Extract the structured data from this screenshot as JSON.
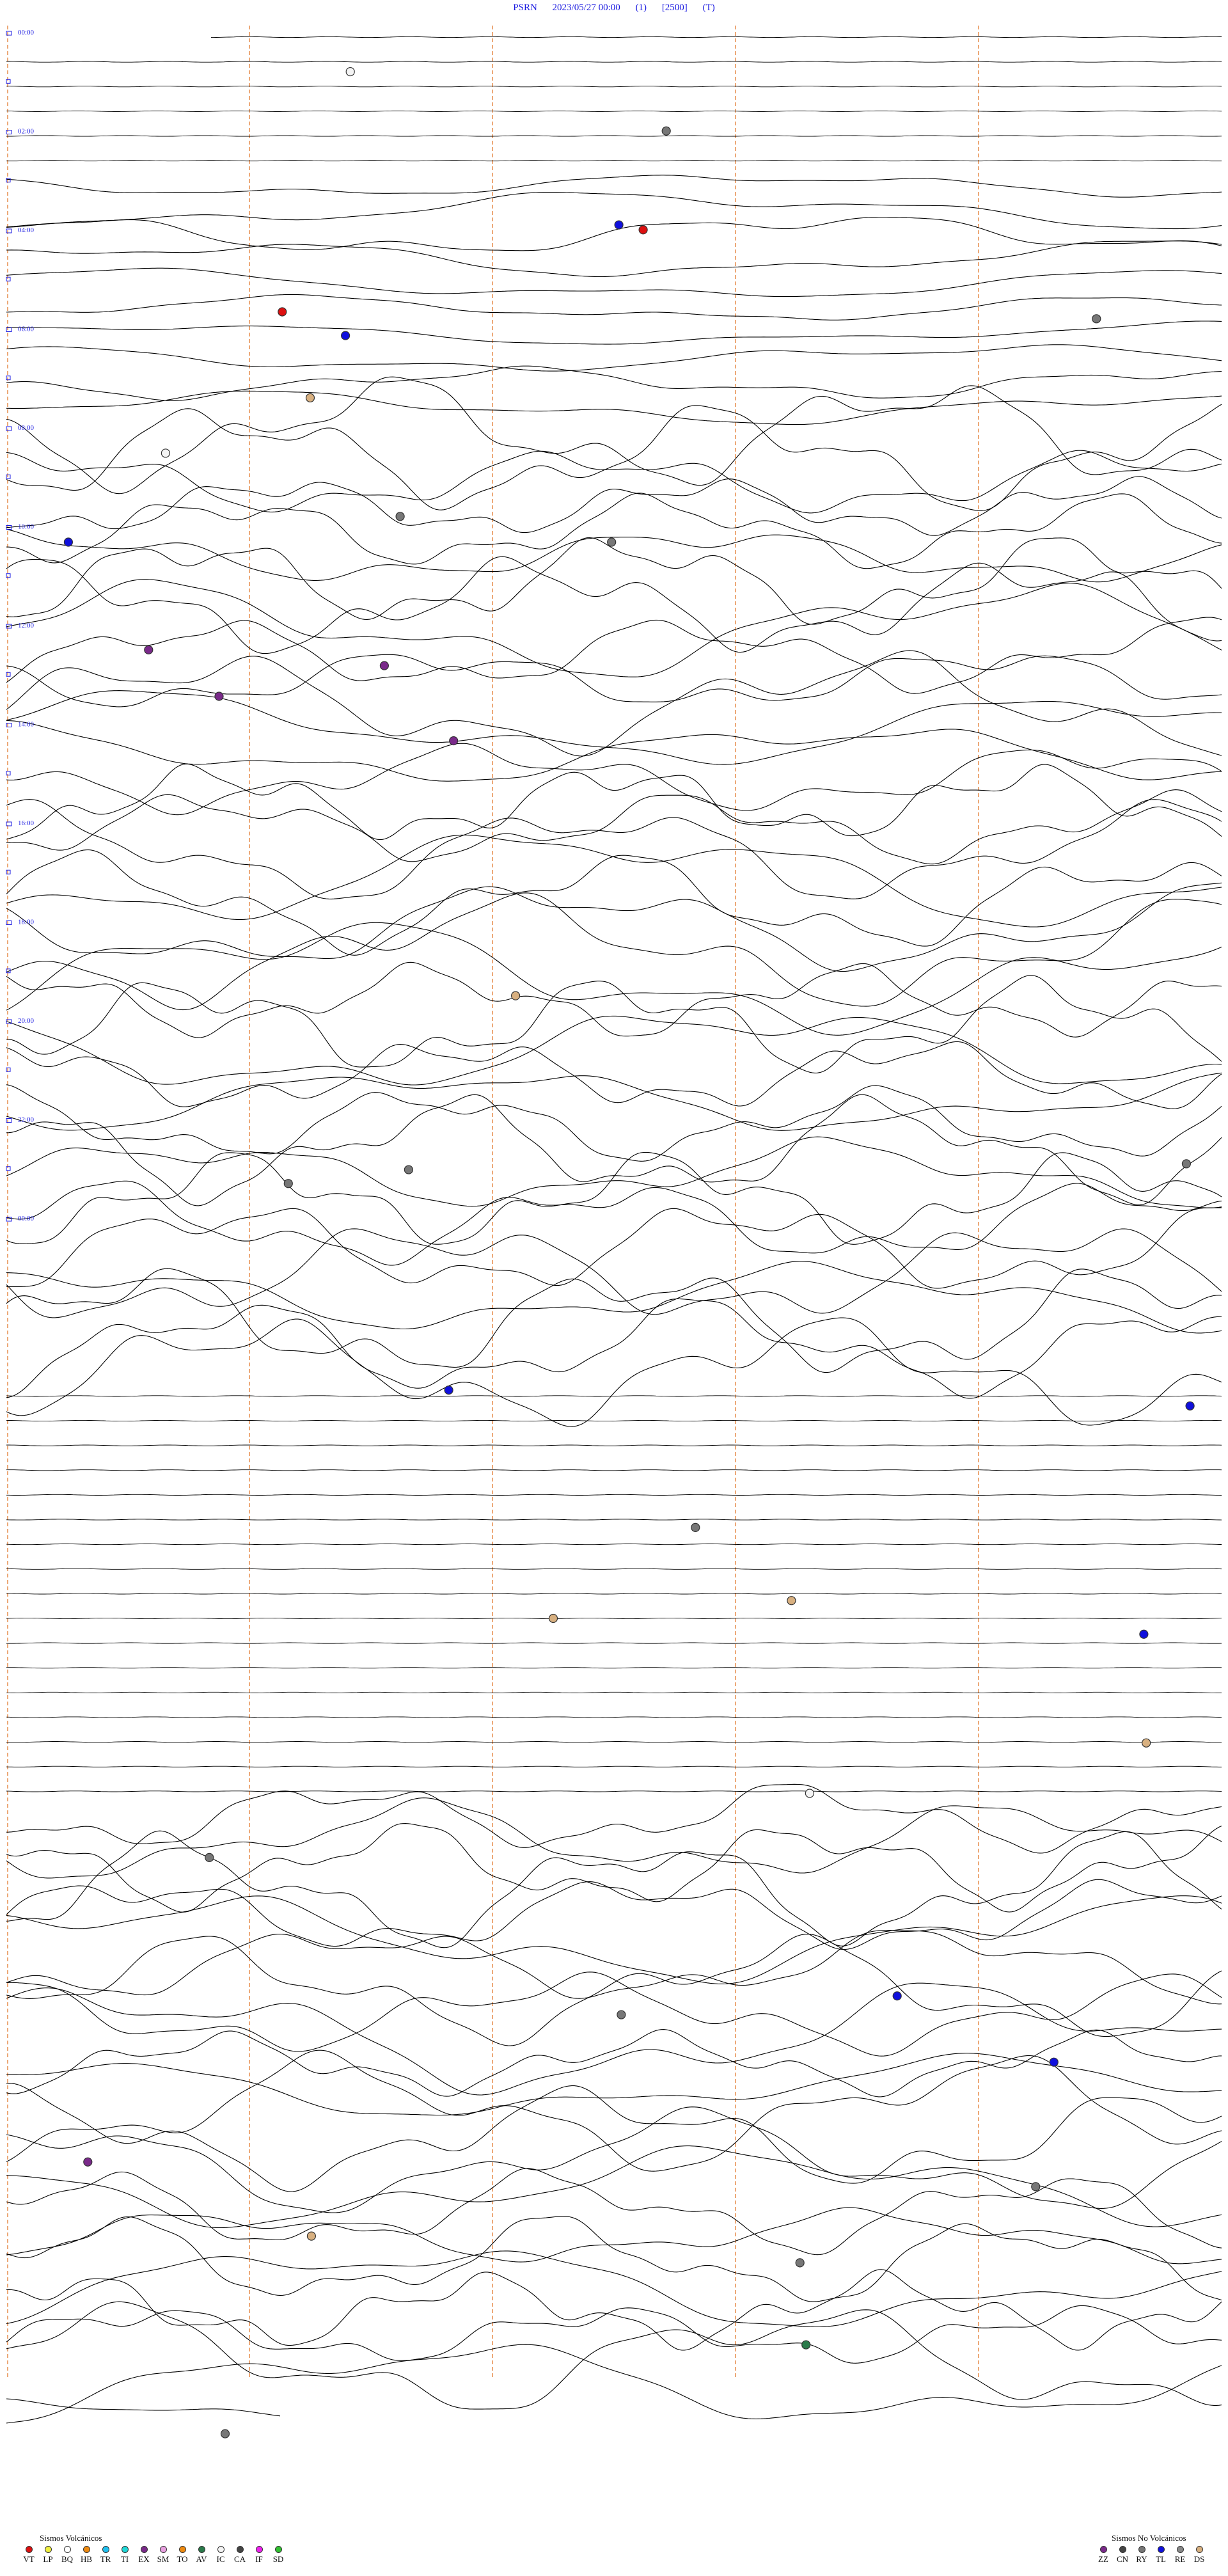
{
  "header": {
    "station": "PSRN",
    "datetime": "2023/05/27 00:00",
    "channel": "(1)",
    "gain": "[2500]",
    "flag": "(T)"
  },
  "chart_data": {
    "type": "helicorder",
    "title": "",
    "hour_labels": [
      "00:00",
      "02:00",
      "04:00",
      "06:00",
      "08:00",
      "10:00",
      "12:00",
      "14:00",
      "16:00",
      "18:00",
      "20:00",
      "22:00",
      "00:00"
    ],
    "rows_per_hour": 4,
    "total_rows": 97,
    "grid_dashed_positions": [
      0,
      0.2,
      0.4,
      0.6,
      0.8
    ],
    "grid_color": "#e07020",
    "trace_color": "#000000",
    "activity_periods": [
      {
        "from_hour": 1.4,
        "to_hour": 3.9,
        "level": "low"
      },
      {
        "from_hour": 4.0,
        "to_hour": 13.6,
        "level": "high"
      },
      {
        "from_hour": 13.7,
        "to_hour": 17.8,
        "level": "quiet"
      },
      {
        "from_hour": 17.9,
        "to_hour": 23.8,
        "level": "high"
      },
      {
        "from_hour": 23.9,
        "to_hour": 24.3,
        "level": "low"
      }
    ],
    "events": [
      {
        "type": "IC",
        "color": "#f4f4f4",
        "x": 0.283,
        "hour": 0.35
      },
      {
        "type": "CA",
        "color": "#777777",
        "x": 0.543,
        "hour": 0.95
      },
      {
        "type": "TL",
        "color": "#1010dd",
        "x": 0.504,
        "hour": 1.9
      },
      {
        "type": "VT",
        "color": "#dd1010",
        "x": 0.524,
        "hour": 1.95
      },
      {
        "type": "VT",
        "color": "#dd1010",
        "x": 0.227,
        "hour": 2.78
      },
      {
        "type": "TL",
        "color": "#1010dd",
        "x": 0.279,
        "hour": 3.02
      },
      {
        "type": "CA",
        "color": "#777777",
        "x": 0.897,
        "hour": 2.85
      },
      {
        "type": "RE",
        "color": "#d8b080",
        "x": 0.25,
        "hour": 3.65
      },
      {
        "type": "IC",
        "color": "#f4f4f4",
        "x": 0.131,
        "hour": 4.21
      },
      {
        "type": "CA",
        "color": "#777777",
        "x": 0.324,
        "hour": 4.85
      },
      {
        "type": "TL",
        "color": "#1010dd",
        "x": 0.051,
        "hour": 5.11
      },
      {
        "type": "CA",
        "color": "#777777",
        "x": 0.498,
        "hour": 5.11
      },
      {
        "type": "ZZ",
        "color": "#7a2a8a",
        "x": 0.117,
        "hour": 6.2
      },
      {
        "type": "ZZ",
        "color": "#7a2a8a",
        "x": 0.311,
        "hour": 6.36
      },
      {
        "type": "ZZ",
        "color": "#7a2a8a",
        "x": 0.175,
        "hour": 6.67
      },
      {
        "type": "ZZ",
        "color": "#7a2a8a",
        "x": 0.368,
        "hour": 7.12
      },
      {
        "type": "RE",
        "color": "#d8b080",
        "x": 0.419,
        "hour": 9.7
      },
      {
        "type": "CA",
        "color": "#777777",
        "x": 0.232,
        "hour": 11.6
      },
      {
        "type": "CA",
        "color": "#777777",
        "x": 0.331,
        "hour": 11.46
      },
      {
        "type": "CA",
        "color": "#777777",
        "x": 0.971,
        "hour": 11.4
      },
      {
        "type": "TL",
        "color": "#1010dd",
        "x": 0.364,
        "hour": 13.69
      },
      {
        "type": "TL",
        "color": "#1010dd",
        "x": 0.974,
        "hour": 13.85
      },
      {
        "type": "CA",
        "color": "#777777",
        "x": 0.567,
        "hour": 15.08
      },
      {
        "type": "RE",
        "color": "#d8b080",
        "x": 0.646,
        "hour": 15.82
      },
      {
        "type": "RE",
        "color": "#d8b080",
        "x": 0.45,
        "hour": 16.0
      },
      {
        "type": "TL",
        "color": "#1010dd",
        "x": 0.936,
        "hour": 16.16
      },
      {
        "type": "RE",
        "color": "#d8b080",
        "x": 0.938,
        "hour": 17.26
      },
      {
        "type": "IC",
        "color": "#f4f4f4",
        "x": 0.661,
        "hour": 17.77
      },
      {
        "type": "CA",
        "color": "#777777",
        "x": 0.167,
        "hour": 18.42
      },
      {
        "type": "TL",
        "color": "#1010dd",
        "x": 0.733,
        "hour": 19.82
      },
      {
        "type": "CA",
        "color": "#777777",
        "x": 0.506,
        "hour": 20.01
      },
      {
        "type": "TL",
        "color": "#1010dd",
        "x": 0.862,
        "hour": 20.49
      },
      {
        "type": "ZZ",
        "color": "#7a2a8a",
        "x": 0.067,
        "hour": 21.5
      },
      {
        "type": "CA",
        "color": "#777777",
        "x": 0.847,
        "hour": 21.75
      },
      {
        "type": "RE",
        "color": "#d8b080",
        "x": 0.251,
        "hour": 22.25
      },
      {
        "type": "CA",
        "color": "#777777",
        "x": 0.653,
        "hour": 22.52
      },
      {
        "type": "AV",
        "color": "#2a7a4a",
        "x": 0.658,
        "hour": 23.35
      },
      {
        "type": "CA",
        "color": "#777777",
        "x": 0.18,
        "hour": 24.25
      }
    ]
  },
  "legend_volcanic": {
    "title": "Sismos Volcánicos",
    "items": [
      {
        "code": "VT",
        "color": "#dd1010"
      },
      {
        "code": "LP",
        "color": "#f0f040"
      },
      {
        "code": "BQ",
        "color": "#ffffff"
      },
      {
        "code": "HB",
        "color": "#ee8a10"
      },
      {
        "code": "TR",
        "color": "#20c0ee"
      },
      {
        "code": "TI",
        "color": "#20d8d8"
      },
      {
        "code": "EX",
        "color": "#7a2a8a"
      },
      {
        "code": "SM",
        "color": "#e8a0e0"
      },
      {
        "code": "TO",
        "color": "#ee8a10"
      },
      {
        "code": "AV",
        "color": "#2a7a4a"
      },
      {
        "code": "IC",
        "color": "#f4f4f4"
      },
      {
        "code": "CA",
        "color": "#444444"
      },
      {
        "code": "IF",
        "color": "#ee20ee"
      },
      {
        "code": "SD",
        "color": "#30c030"
      }
    ]
  },
  "legend_nonvolcanic": {
    "title": "Sismos No Volcánicos",
    "items": [
      {
        "code": "ZZ",
        "color": "#7a2a8a"
      },
      {
        "code": "CN",
        "color": "#444444"
      },
      {
        "code": "RY",
        "color": "#777777"
      },
      {
        "code": "TL",
        "color": "#1010dd"
      },
      {
        "code": "RE",
        "color": "#888888"
      },
      {
        "code": "DS",
        "color": "#d8b080"
      }
    ]
  }
}
